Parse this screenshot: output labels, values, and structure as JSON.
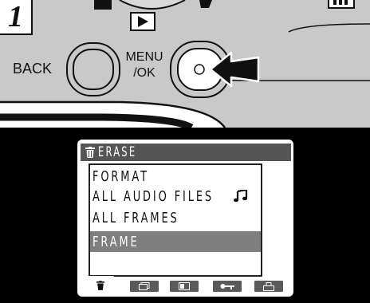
{
  "step": {
    "number": "1"
  },
  "camera": {
    "back_label": "BACK",
    "menu_ok_label_line1": "MENU",
    "menu_ok_label_line2": "/OK"
  },
  "lcd": {
    "menu_title": "ERASE",
    "title_icon": "trash-icon",
    "items": [
      {
        "label": "FORMAT",
        "selected": false
      },
      {
        "label": "ALL AUDIO FILES",
        "icon": "music-note-icon",
        "selected": false
      },
      {
        "label": "ALL FRAMES",
        "selected": false
      },
      {
        "label": "FRAME",
        "selected": true
      }
    ],
    "tabs": [
      {
        "icon": "trash-icon",
        "active": true
      },
      {
        "icon": "frames-icon",
        "active": false
      },
      {
        "icon": "single-frame-icon",
        "active": false
      },
      {
        "icon": "key-protect-icon",
        "active": false
      },
      {
        "icon": "print-order-icon",
        "active": false
      }
    ]
  },
  "colors": {
    "camera_body": "#c9c9c9",
    "lcd_title_bg": "#555555",
    "selection_bg": "#7f7f7f"
  }
}
